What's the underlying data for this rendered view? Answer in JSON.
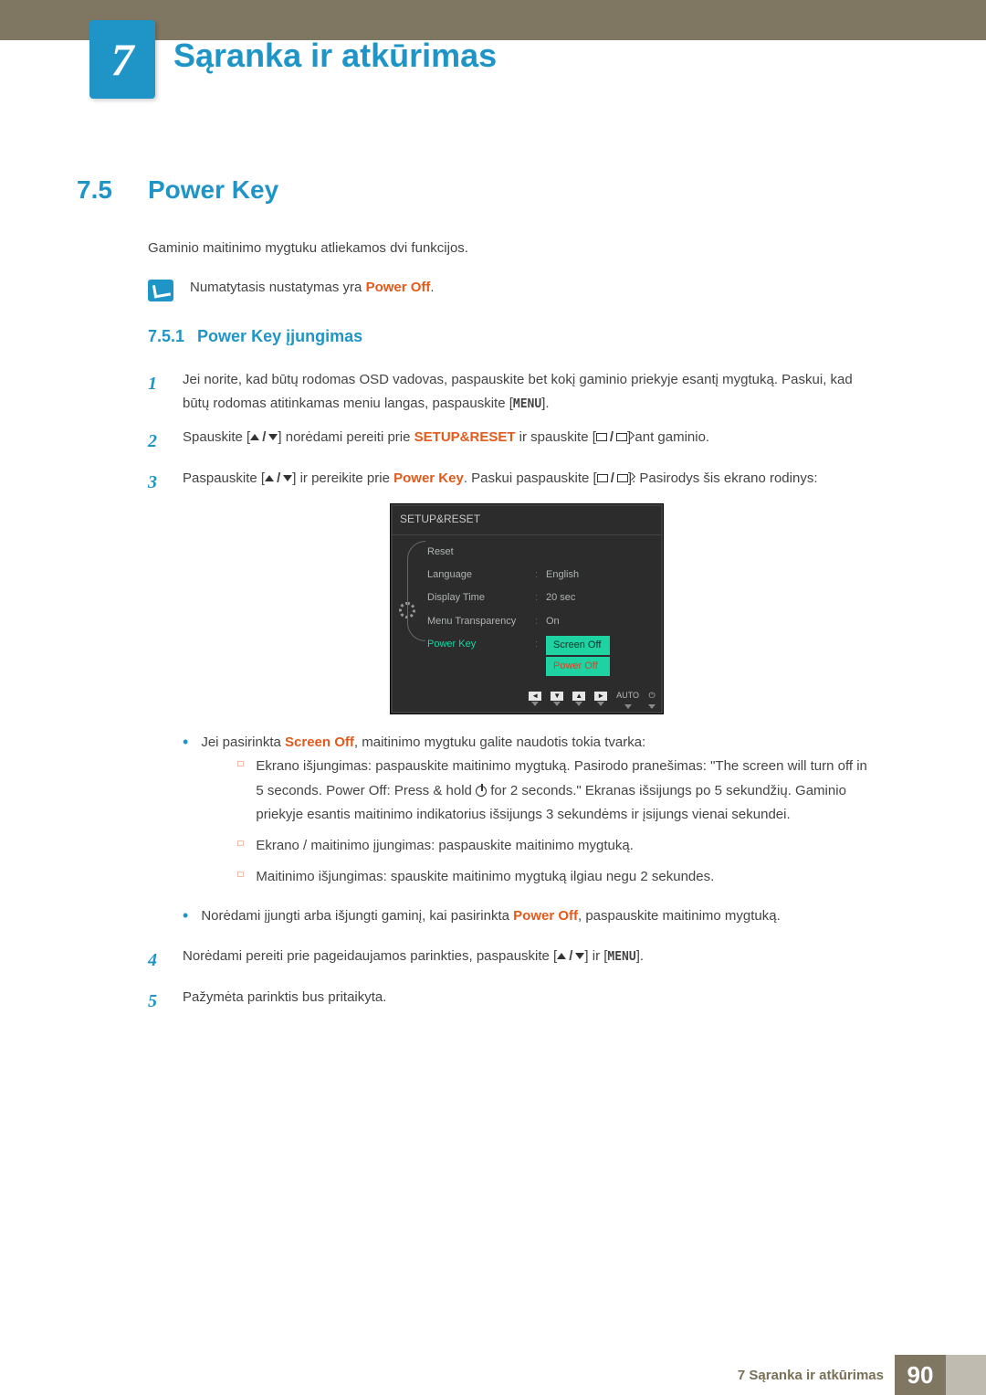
{
  "chapter": {
    "number": "7",
    "title": "Sąranka ir atkūrimas"
  },
  "section": {
    "number": "7.5",
    "title": "Power Key",
    "intro": "Gaminio maitinimo mygtuku atliekamos dvi funkcijos.",
    "note_prefix": "Numatytasis nustatymas yra ",
    "note_highlight": "Power Off",
    "note_suffix": "."
  },
  "subsection": {
    "number": "7.5.1",
    "title": "Power Key įjungimas"
  },
  "steps": {
    "s1": "Jei norite, kad būtų rodomas OSD vadovas, paspauskite bet kokį gaminio priekyje esantį mygtuką. Paskui, kad būtų rodomas atitinkamas meniu langas, paspauskite [",
    "s1_end": "].",
    "s2_a": "Spauskite [",
    "s2_b": "] norėdami pereiti prie ",
    "s2_hl": "SETUP&RESET",
    "s2_c": " ir spauskite [",
    "s2_d": "] ant gaminio.",
    "s3_a": "Paspauskite [",
    "s3_b": "] ir pereikite prie ",
    "s3_hl": "Power Key",
    "s3_c": ". Paskui paspauskite [",
    "s3_d": "]. Pasirodys šis ekrano rodinys:",
    "s4_a": "Norėdami pereiti prie pageidaujamos parinkties, paspauskite [",
    "s4_b": "] ir [",
    "s4_c": "].",
    "s5": "Pažymėta parinktis bus pritaikyta."
  },
  "menu_label": "MENU",
  "osd": {
    "title": "SETUP&RESET",
    "rows": {
      "reset": "Reset",
      "language": "Language",
      "language_val": "English",
      "display_time": "Display Time",
      "display_time_val": "20 sec",
      "menu_transp": "Menu Transparency",
      "menu_transp_val": "On",
      "power_key": "Power Key",
      "opt_screen_off": "Screen Off",
      "opt_power_off": "Power Off"
    },
    "nav_auto": "AUTO"
  },
  "bullets": {
    "b1_a": "Jei pasirinkta ",
    "b1_hl": "Screen Off",
    "b1_b": ", maitinimo mygtuku galite naudotis tokia tvarka:",
    "sb1_a": "Ekrano išjungimas: paspauskite maitinimo mygtuką. Pasirodo pranešimas: \"The screen will turn off in 5 seconds. Power Off: Press & hold ",
    "sb1_b": " for 2 seconds.\" Ekranas išsijungs po 5 sekundžių. Gaminio priekyje esantis maitinimo indikatorius išsijungs 3 sekundėms ir įsijungs vienai sekundei.",
    "sb2": "Ekrano / maitinimo įjungimas: paspauskite maitinimo mygtuką.",
    "sb3": "Maitinimo išjungimas: spauskite maitinimo mygtuką ilgiau negu 2 sekundes.",
    "b2_a": "Norėdami įjungti arba išjungti gaminį, kai pasirinkta ",
    "b2_hl": "Power Off",
    "b2_b": ", paspauskite maitinimo mygtuką."
  },
  "footer": {
    "text_prefix": "7 ",
    "text": "Sąranka ir atkūrimas",
    "page": "90"
  }
}
